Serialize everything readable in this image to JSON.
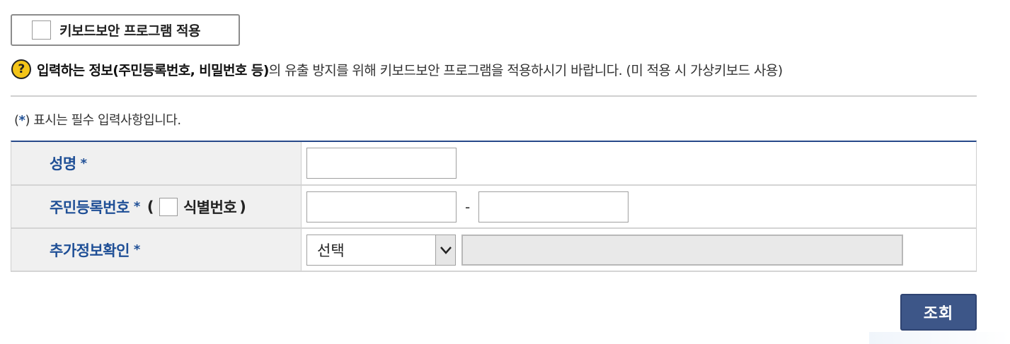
{
  "keyboard_security": {
    "label": "키보드보안 프로그램 적용",
    "checked": false
  },
  "notice": {
    "icon": "question-icon",
    "bold_text": "입력하는 정보(주민등록번호, 비밀번호 등)",
    "normal_text": "의 유출 방지를 위해 키보드보안 프로그램을 적용하시기 바랍니다. (미 적용 시 가상키보드 사용)"
  },
  "required_note": {
    "open": "(",
    "star": "*",
    "text": ") 표시는 필수 입력사항입니다."
  },
  "form": {
    "name_label": "성명",
    "rrn_label": "주민등록번호",
    "rrn_paren_open": "(",
    "rrn_sub_label": "식별번호",
    "rrn_paren_close": ")",
    "rrn_separator": "-",
    "extra_label": "추가정보확인",
    "extra_select_value": "선택",
    "required_star": "*"
  },
  "search_button": {
    "label": "조회"
  },
  "colors": {
    "accent": "#1f4f96",
    "button": "#3d5688",
    "icon_yellow": "#f3c418"
  }
}
